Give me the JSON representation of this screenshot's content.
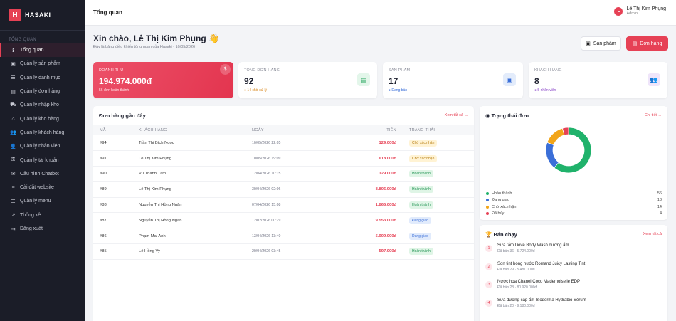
{
  "brand": {
    "logo_letter": "H",
    "name": "HASAKI"
  },
  "sidebar": {
    "section_label": "TỔNG QUAN",
    "items": [
      {
        "label": "Tổng quan",
        "icon": "info-icon",
        "glyph": "ℹ",
        "active": true
      },
      {
        "label": "Quản lý sản phẩm",
        "icon": "box-icon",
        "glyph": "▣"
      },
      {
        "label": "Quản lý danh mục",
        "icon": "list-icon",
        "glyph": "☰"
      },
      {
        "label": "Quản lý đơn hàng",
        "icon": "receipt-icon",
        "glyph": "▤"
      },
      {
        "label": "Quản lý nhập kho",
        "icon": "truck-icon",
        "glyph": "⛟"
      },
      {
        "label": "Quản lý kho hàng",
        "icon": "warehouse-icon",
        "glyph": "⌂"
      },
      {
        "label": "Quản lý khách hàng",
        "icon": "users-icon",
        "glyph": "👥"
      },
      {
        "label": "Quản lý nhân viên",
        "icon": "user-icon",
        "glyph": "👤"
      },
      {
        "label": "Quản lý tài khoản",
        "icon": "key-icon",
        "glyph": "⚿"
      },
      {
        "label": "Cấu hình Chatbot",
        "icon": "chat-icon",
        "glyph": "✉"
      },
      {
        "label": "Cài đặt website",
        "icon": "sliders-icon",
        "glyph": "≡"
      },
      {
        "label": "Quản lý menu",
        "icon": "menu-icon",
        "glyph": "☰"
      },
      {
        "label": "Thống kê",
        "icon": "chart-line-icon",
        "glyph": "↗"
      },
      {
        "label": "Đăng xuất",
        "icon": "logout-icon",
        "glyph": "⇥"
      }
    ]
  },
  "topbar": {
    "title": "Tổng quan",
    "user_initial": "L",
    "user_name": "Lê Thị Kim Phụng",
    "user_role": "Admin"
  },
  "greeting": {
    "title": "Xin chào, Lê Thị Kim Phụng 👋",
    "subtitle": "Đây là bảng điều khiển tổng quan của Hasaki - 10/05/2026"
  },
  "actions": {
    "products_label": "Sản phẩm",
    "orders_label": "Đơn hàng"
  },
  "stats": [
    {
      "label": "DOANH THU",
      "value": "194.974.000đ",
      "note": "56 đơn hoàn thành"
    },
    {
      "label": "TỔNG ĐƠN HÀNG",
      "value": "92",
      "note": "● 14 chờ xử lý"
    },
    {
      "label": "SẢN PHẨM",
      "value": "17",
      "note": "● Đang bán"
    },
    {
      "label": "KHÁCH HÀNG",
      "value": "8",
      "note": "● 5 nhân viên"
    }
  ],
  "recent_orders": {
    "title": "Đơn hàng gần đây",
    "link": "Xem tất cả →",
    "columns": [
      "MÃ",
      "KHÁCH HÀNG",
      "NGÀY",
      "TIỀN",
      "TRẠNG THÁI"
    ],
    "rows": [
      {
        "id": "#94",
        "customer": "Trần Thị Bích Ngọc",
        "date": "10/05/2026 22:05",
        "amount": "129.000đ",
        "status": "Chờ xác nhận",
        "kind": "pending"
      },
      {
        "id": "#91",
        "customer": "Lê Thị Kim Phụng",
        "date": "10/05/2026 19:09",
        "amount": "618.000đ",
        "status": "Chờ xác nhận",
        "kind": "pending"
      },
      {
        "id": "#90",
        "customer": "Vũ Thanh Tâm",
        "date": "12/04/2026 10:15",
        "amount": "129.000đ",
        "status": "Hoàn thành",
        "kind": "done"
      },
      {
        "id": "#89",
        "customer": "Lê Thị Kim Phụng",
        "date": "30/04/2026 02:06",
        "amount": "8.806.000đ",
        "status": "Hoàn thành",
        "kind": "done"
      },
      {
        "id": "#88",
        "customer": "Nguyễn Thị Hồng Ngân",
        "date": "07/04/2026 15:08",
        "amount": "1.865.000đ",
        "status": "Hoàn thành",
        "kind": "done"
      },
      {
        "id": "#87",
        "customer": "Nguyễn Thị Hồng Ngân",
        "date": "12/02/2026 00:29",
        "amount": "9.553.000đ",
        "status": "Đang giao",
        "kind": "ship"
      },
      {
        "id": "#86",
        "customer": "Phạm Mai Anh",
        "date": "13/04/2026 13:40",
        "amount": "5.909.000đ",
        "status": "Đang giao",
        "kind": "ship"
      },
      {
        "id": "#85",
        "customer": "Lê Hồng Vy",
        "date": "20/04/2026 03:45",
        "amount": "597.000đ",
        "status": "Hoàn thành",
        "kind": "done"
      }
    ]
  },
  "order_status": {
    "title": "Trạng thái đơn",
    "link": "Chi tiết →",
    "chart_data": {
      "type": "pie",
      "title": "",
      "categories": [
        "Hoàn thành",
        "Đang giao",
        "Chờ xác nhận",
        "Đã hủy"
      ],
      "values": [
        56,
        18,
        14,
        4
      ],
      "colors": [
        "#20b26b",
        "#3b6fd8",
        "#f2a519",
        "#e64155"
      ]
    }
  },
  "best_sellers": {
    "title": "Bán chạy",
    "link": "Xem tất cả",
    "items": [
      {
        "rank": "1",
        "name": "Sữa tắm Dove Body Wash dưỡng ẩm",
        "meta": "Đã bán 36 · 5.724.000đ"
      },
      {
        "rank": "2",
        "name": "Son tint bóng nước Romand Juicy Lasting Tint",
        "meta": "Đã bán 29 · 5.481.000đ"
      },
      {
        "rank": "3",
        "name": "Nước hoa Chanel Coco Mademoiselle EDP",
        "meta": "Đã bán 28 · 80.920.000đ"
      },
      {
        "rank": "4",
        "name": "Sữa dưỡng cấp ẩm Bioderma Hydrabio Sérum",
        "meta": "Đã bán 20 · 9.180.000đ"
      }
    ]
  },
  "colors": {
    "accent": "#e64155",
    "sidebar_bg": "#1b1d28"
  }
}
